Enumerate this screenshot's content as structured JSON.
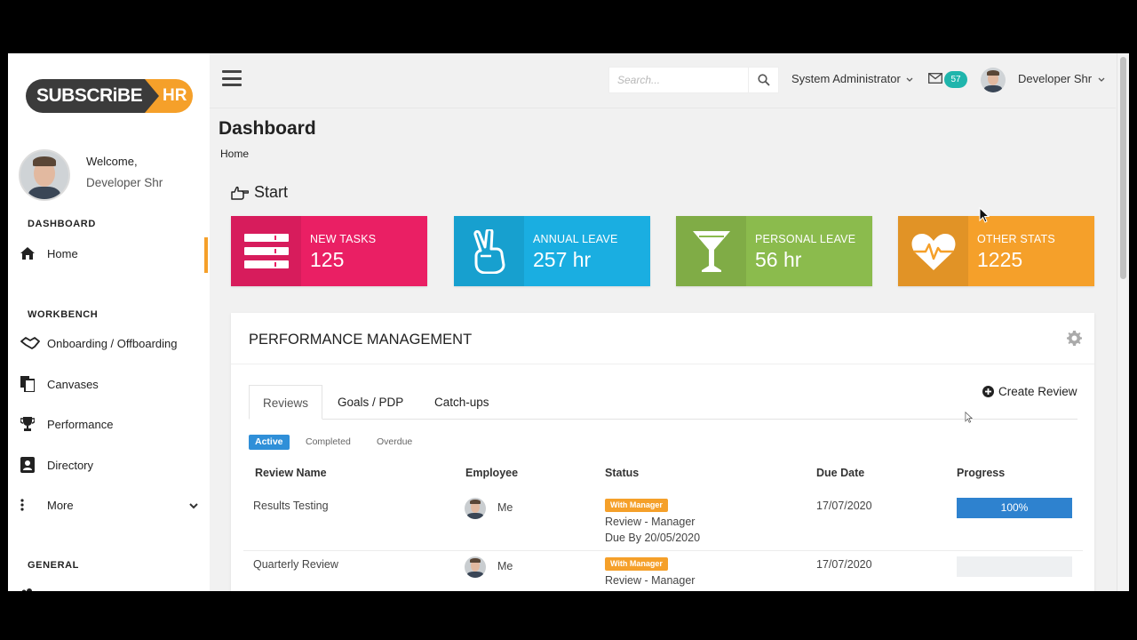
{
  "brand": {
    "part1": "SUBSCRiBE",
    "part2": "HR"
  },
  "sidebar": {
    "welcome": "Welcome,",
    "user_name": "Developer Shr",
    "sections": {
      "dashboard": "DASHBOARD",
      "workbench": "WORKBENCH",
      "general": "GENERAL"
    },
    "items": [
      {
        "label": "Home",
        "icon": "home-icon"
      },
      {
        "label": "Onboarding / Offboarding",
        "icon": "handshake-icon"
      },
      {
        "label": "Canvases",
        "icon": "copy-icon"
      },
      {
        "label": "Performance",
        "icon": "trophy-icon"
      },
      {
        "label": "Directory",
        "icon": "contact-card-icon"
      },
      {
        "label": "More",
        "icon": "vertical-dots-icon"
      }
    ]
  },
  "topbar": {
    "search_placeholder": "Search...",
    "role_menu": "System Administrator",
    "mail_count": "57",
    "user_menu": "Developer Shr"
  },
  "page": {
    "title": "Dashboard",
    "breadcrumb": "Home",
    "start": "Start"
  },
  "stats": [
    {
      "label": "NEW TASKS",
      "value": "125",
      "color": "#ea1f64",
      "icon": "list-icon"
    },
    {
      "label": "ANNUAL LEAVE",
      "value": "257 hr",
      "color": "#1aaee1",
      "icon": "peace-hand-icon"
    },
    {
      "label": "PERSONAL LEAVE",
      "value": "56 hr",
      "color": "#8bbb4d",
      "icon": "cocktail-icon"
    },
    {
      "label": "OTHER STATS",
      "value": "1225",
      "color": "#f5a02a",
      "icon": "heartbeat-icon"
    }
  ],
  "performance": {
    "title": "PERFORMANCE MANAGEMENT",
    "create_label": "Create Review",
    "tabs": [
      "Reviews",
      "Goals / PDP",
      "Catch-ups"
    ],
    "filters": [
      "Active",
      "Completed",
      "Overdue"
    ],
    "columns": [
      "Review Name",
      "Employee",
      "Status",
      "Due Date",
      "Progress"
    ],
    "rows": [
      {
        "name": "Results Testing",
        "employee": "Me",
        "badge": "With Manager",
        "status_line1": "Review - Manager",
        "status_line2": "Due By 20/05/2020",
        "due": "17/07/2020",
        "progress_label": "100%",
        "progress": 1.0
      },
      {
        "name": "Quarterly Review",
        "employee": "Me",
        "badge": "With Manager",
        "status_line1": "Review - Manager",
        "status_line2": "",
        "due": "17/07/2020",
        "progress_label": "",
        "progress": 0
      }
    ]
  }
}
